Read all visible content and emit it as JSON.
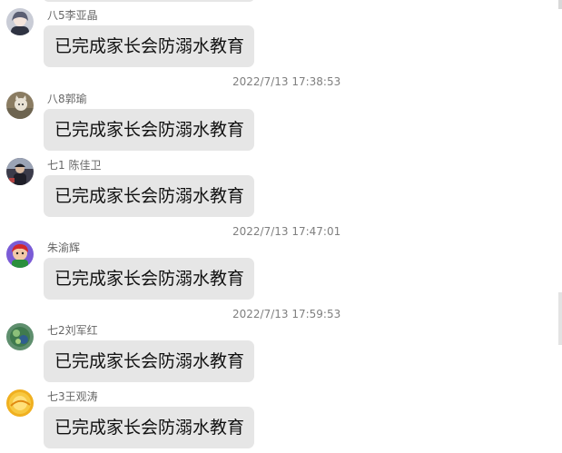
{
  "messages": [
    {
      "sender": "八5李亚晶",
      "text": "已完成家长会防溺水教育",
      "avatar_icon": "anime-girl-avatar",
      "avatar_color": "#c9ccd6"
    },
    {
      "timestamp": "2022/7/13 17:38:53",
      "sender": "八8郭瑜",
      "text": "已完成家长会防溺水教育",
      "avatar_icon": "cat-photo-avatar",
      "avatar_color": "#8a7c62"
    },
    {
      "sender": "七1 陈佳卫",
      "text": "已完成家长会防溺水教育",
      "avatar_icon": "person-photo-avatar",
      "avatar_color": "#3b3b4a"
    },
    {
      "timestamp": "2022/7/13 17:47:01",
      "sender": "朱渝辉",
      "text": "已完成家长会防溺水教育",
      "avatar_icon": "cartoon-character-avatar",
      "avatar_color": "#7a5bd6"
    },
    {
      "timestamp": "2022/7/13 17:59:53",
      "sender": "七2刘军红",
      "text": "已完成家长会防溺水教育",
      "avatar_icon": "landscape-avatar",
      "avatar_color": "#5f8f6e"
    },
    {
      "sender": "七3王观涛",
      "text": "已完成家长会防溺水教育",
      "avatar_icon": "orange-abstract-avatar",
      "avatar_color": "#f0b020"
    }
  ]
}
